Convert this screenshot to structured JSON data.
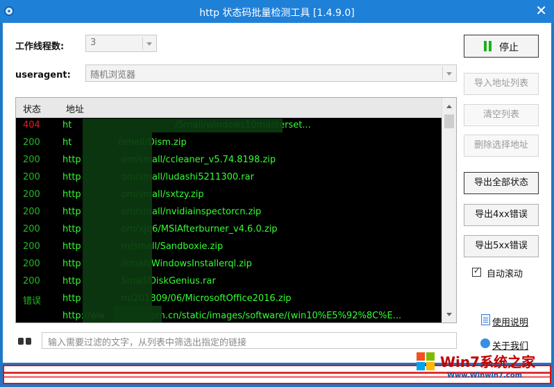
{
  "window": {
    "title": "http 状态码批量检测工具 [1.4.9.0]",
    "close": "✕"
  },
  "settings": {
    "threads_label": "工作线程数:",
    "threads_value": "3",
    "useragent_label": "useragent:",
    "useragent_value": "随机浏览器"
  },
  "list": {
    "columns": [
      "状态",
      "地址"
    ],
    "rows": [
      {
        "status": "404",
        "kind": "bad",
        "url": "ht                                    /Small/windows10masterset..."
      },
      {
        "status": "200",
        "kind": "ok",
        "url": "ht                /small/Dism.zip"
      },
      {
        "status": "200",
        "kind": "ok",
        "url": "http              om/small/ccleaner_v5.74.8198.zip"
      },
      {
        "status": "200",
        "kind": "ok",
        "url": "http              om/small/ludashi5211300.rar"
      },
      {
        "status": "200",
        "kind": "ok",
        "url": "http              om/small/sxtzy.zip"
      },
      {
        "status": "200",
        "kind": "ok",
        "url": "http              om/small/nvidiainspectorcn.zip"
      },
      {
        "status": "200",
        "kind": "ok",
        "url": "http              om/xjq6/MSIAfterburner_v4.6.0.zip"
      },
      {
        "status": "200",
        "kind": "ok",
        "url": "http              m/small/Sandboxie.zip"
      },
      {
        "status": "200",
        "kind": "ok",
        "url": "http              /small/WindowsInstallerql.zip"
      },
      {
        "status": "200",
        "kind": "ok",
        "url": "http              Small/DiskGenius.rar"
      },
      {
        "status": "错误",
        "kind": "err",
        "url": "http              m/201809/06/MicrosoftOffice2016.zip"
      },
      {
        "status": "",
        "kind": "ok",
        "url": "http://ww                om.cn/static/images/software/(win10%E5%92%8C%E..."
      }
    ]
  },
  "buttons": {
    "stop": "停止",
    "import": "导入地址列表",
    "clear": "清空列表",
    "delete": "删除选择地址",
    "export_all": "导出全部状态",
    "export_4xx": "导出4xx错误",
    "export_5xx": "导出5xx错误"
  },
  "auto_scroll": {
    "label": "自动滚动",
    "checked": true
  },
  "links": {
    "help": "使用说明",
    "about": "关于我们"
  },
  "filter": {
    "placeholder": "输入需要过滤的文字，从列表中筛选出指定的链接"
  },
  "watermark": {
    "brand": "Win7系统之家",
    "url": "Www.Winwin7.com"
  }
}
